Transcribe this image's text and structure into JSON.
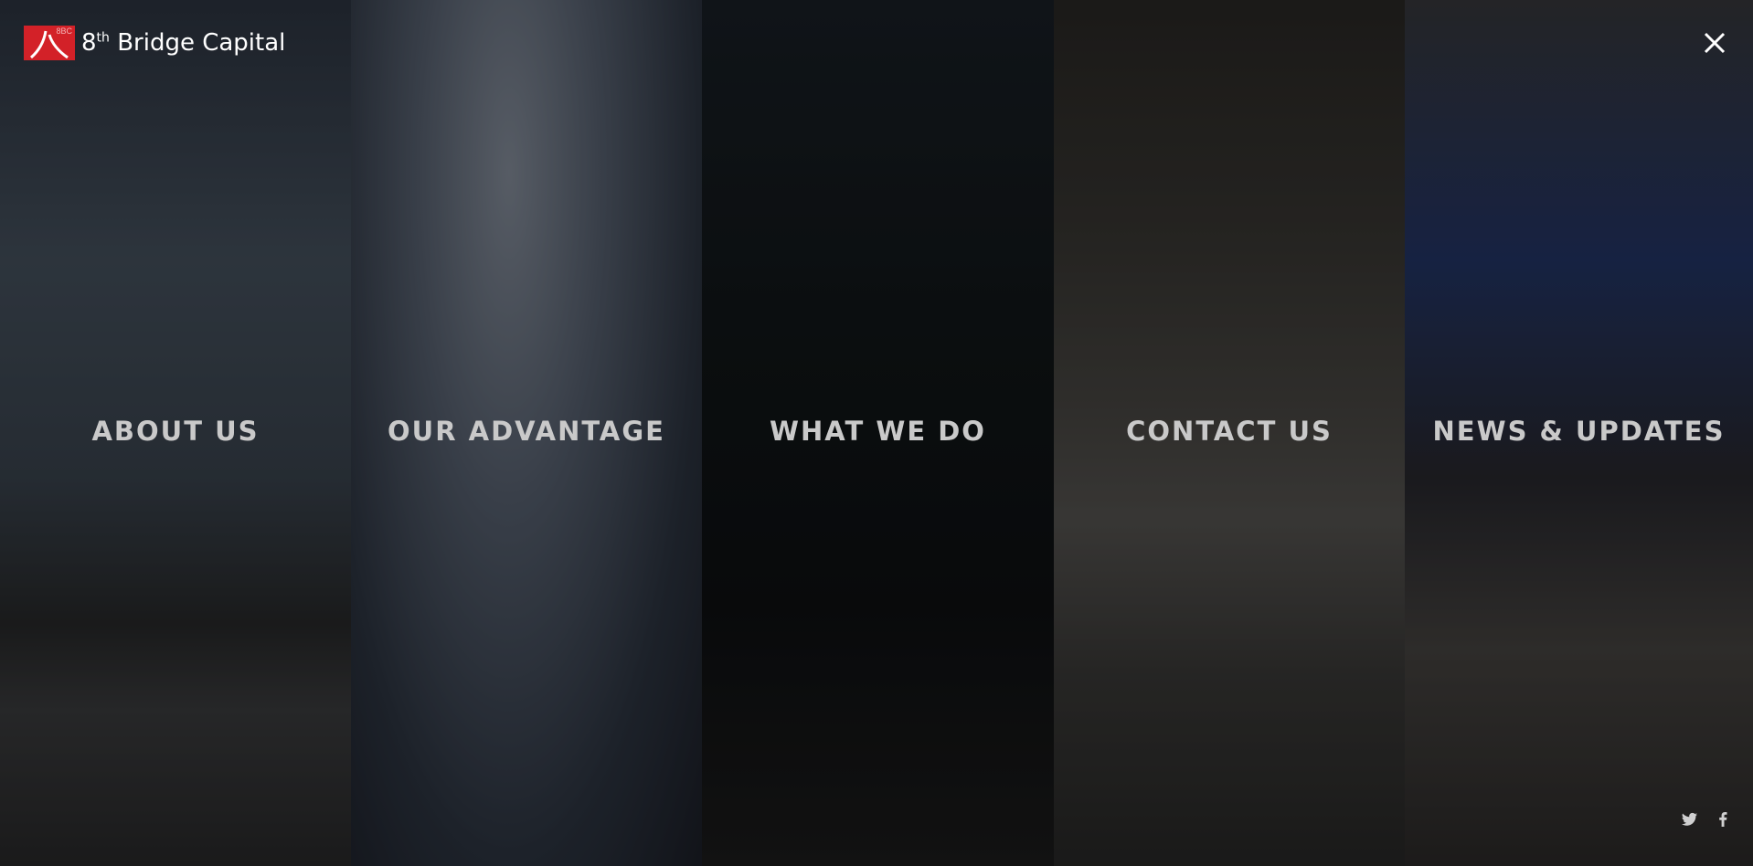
{
  "logo": {
    "mark_text": "8BC",
    "name_prefix": "8",
    "name_sup": "th",
    "name_rest": "Bridge Capital"
  },
  "nav": [
    {
      "label": "ABOUT US"
    },
    {
      "label": "OUR ADVANTAGE"
    },
    {
      "label": "WHAT WE DO"
    },
    {
      "label": "CONTACT US"
    },
    {
      "label": "NEWS & UPDATES"
    }
  ],
  "icons": {
    "close": "close-icon",
    "twitter": "twitter-icon",
    "facebook": "facebook-icon"
  },
  "colors": {
    "brand_red": "#d32128",
    "label": "#c9c9c9"
  }
}
